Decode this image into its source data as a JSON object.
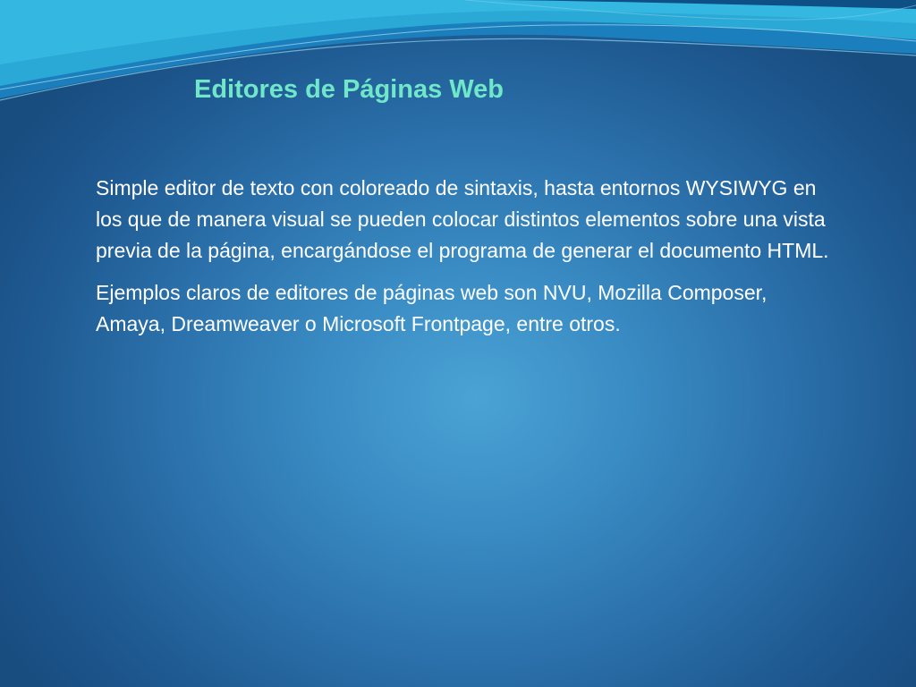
{
  "slide": {
    "title": "Editores de Páginas Web",
    "paragraphs": [
      "Simple editor de texto con coloreado de sintaxis, hasta entornos WYSIWYG en los que de manera visual se pueden colocar distintos elementos sobre una vista previa de la página, encargándose el programa de generar el documento HTML.",
      "Ejemplos claros de editores de páginas web son NVU, Mozilla Composer, Amaya, Dreamweaver o Microsoft Frontpage, entre otros."
    ]
  },
  "colors": {
    "title": "#6fe7c8",
    "body_text": "#ffffff",
    "background_center": "#4aa3d4",
    "background_edge": "#184d80",
    "wave_light": "#2aa9d6",
    "wave_dark": "#0e4f86"
  }
}
